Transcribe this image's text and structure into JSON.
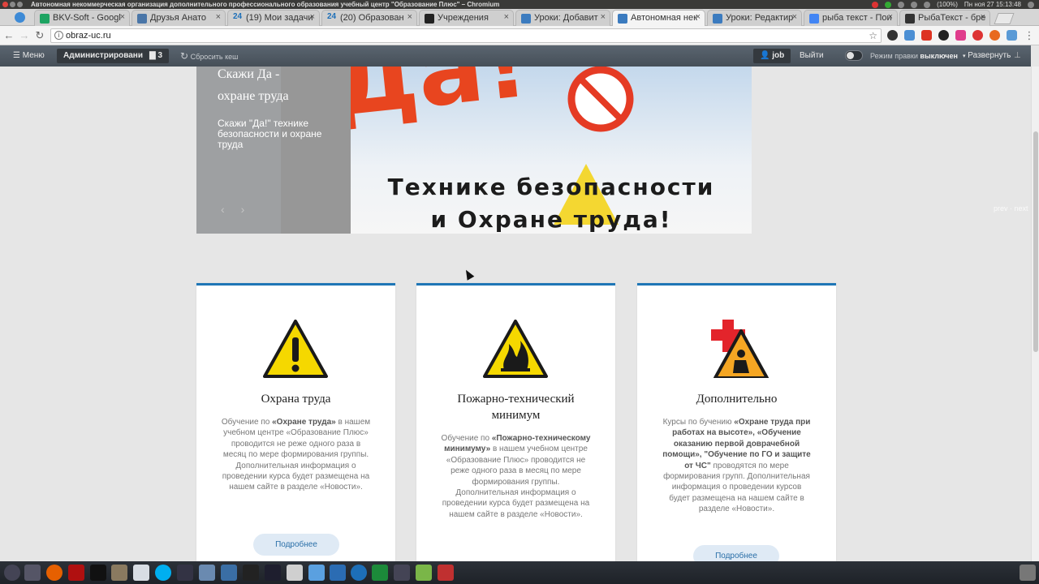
{
  "os": {
    "window_title": "Автономная некоммерческая организация дополнительного профессионального образования учебный центр \"Образование Плюс\" – Chromium",
    "battery": "(100%)",
    "clock": "Пн ноя 27  15:13:48"
  },
  "tabs": [
    {
      "label": "BKV-Soft - Googl",
      "color": "#1da462"
    },
    {
      "label": "Друзья Анато",
      "color": "#4a76a8"
    },
    {
      "label": "(19) Мои задачи",
      "color": "#1d6fb8",
      "prefix": "24"
    },
    {
      "label": "(20) Образован",
      "color": "#1d6fb8",
      "prefix": "24"
    },
    {
      "label": "Учреждения",
      "color": "#222222"
    },
    {
      "label": "Уроки: Добавит",
      "color": "#3b7bbf"
    },
    {
      "label": "Автономная нек",
      "color": "#3b7bbf",
      "active": true
    },
    {
      "label": "Уроки: Редактир",
      "color": "#3b7bbf"
    },
    {
      "label": "рыба текст - Пои",
      "color": "#4285f4"
    },
    {
      "label": "РыбаТекст - бре",
      "color": "#333333"
    }
  ],
  "address": {
    "url": "obraz-uc.ru"
  },
  "admin_bar": {
    "menu": "Меню",
    "admin": "Администрирование",
    "comments_count": "3",
    "reset_cache": "Сбросить кеш",
    "user": "job",
    "logout": "Выйти",
    "edit_mode_label": "Режим правки",
    "edit_mode_state": "выключен",
    "expand": "Развернуть"
  },
  "slider": {
    "heading": "Скажи Да - охране труда",
    "text": "Скажи \"Да!\" технике безопасности и охране труда",
    "banner_big": "Да!",
    "banner_line1": "Технике   безопасности",
    "banner_line2": "и Охране труда!",
    "pager": "prev · next"
  },
  "cards": [
    {
      "title": "Охрана труда",
      "icon": "warning-icon",
      "text_parts": [
        "Обучение по ",
        "«Охране труда»",
        " в нашем учебном центре «Образование Плюс» проводится не реже одного раза в месяц по мере формирования группы. Дополнительная информация о проведении курса будет размещена на нашем сайте в разделе «Новости»."
      ],
      "more": "Подробнее"
    },
    {
      "title": "Пожарно-технический минимум",
      "icon": "fire-hazard-icon",
      "text_parts": [
        "Обучение по ",
        "«Пожарно-техническому минимуму»",
        " в нашем учебном центре «Образование Плюс» проводится не реже одного раза в месяц по мере формирования группы. Дополнительная информация о проведении курса будет размещена на нашем сайте в разделе «Новости»."
      ],
      "more": "Подробнее"
    },
    {
      "title": "Дополнительно",
      "icon": "first-aid-icon",
      "text_parts": [
        "Курсы по бучению ",
        "«Охране труда при работах на высоте», «Обучение оказанию первой доврачебной помощи», \"Обучение по ГО и защите от ЧС\"",
        " проводятся по мере формирования групп. Дополнительная информация о проведении курсов будет размещена на нашем сайте в разделе «Новости»."
      ],
      "more": "Подробнее"
    }
  ],
  "colors": {
    "accent": "#1f76b6",
    "button_bg": "#dfeaf5",
    "admin_bar": "#4e5862"
  }
}
